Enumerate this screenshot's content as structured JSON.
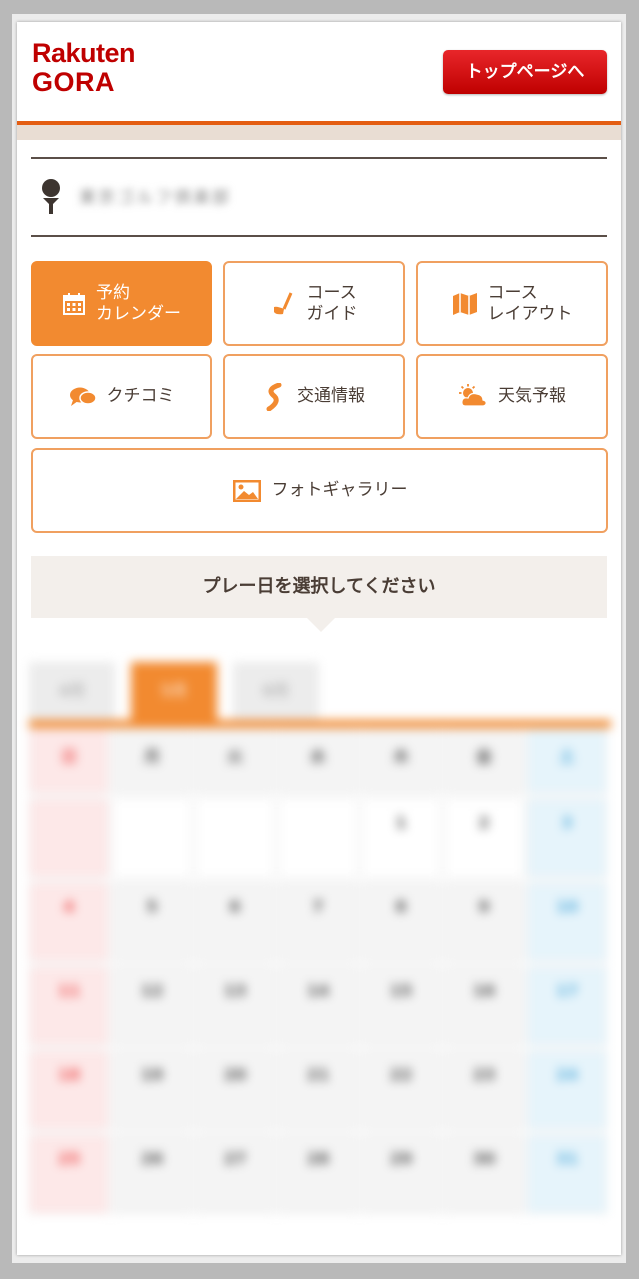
{
  "header": {
    "logo_line1": "Rakuten",
    "logo_line2": "GORA",
    "top_page_button": "トップページへ"
  },
  "course": {
    "name": "東京ゴルフ倶楽部",
    "icon": "golf-tee-icon"
  },
  "nav": [
    {
      "label_line1": "予約",
      "label_line2": "カレンダー",
      "icon": "calendar-icon",
      "active": true
    },
    {
      "label_line1": "コース",
      "label_line2": "ガイド",
      "icon": "golf-club-icon",
      "active": false
    },
    {
      "label_line1": "コース",
      "label_line2": "レイアウト",
      "icon": "map-icon",
      "active": false
    },
    {
      "label_line1": "クチコミ",
      "label_line2": "",
      "icon": "chat-bubbles-icon",
      "active": false
    },
    {
      "label_line1": "交通情報",
      "label_line2": "",
      "icon": "route-icon",
      "active": false
    },
    {
      "label_line1": "天気予報",
      "label_line2": "",
      "icon": "weather-icon",
      "active": false
    },
    {
      "label_line1": "フォトギャラリー",
      "label_line2": "",
      "icon": "image-icon",
      "active": false
    }
  ],
  "prompt": "プレー日を選択してください",
  "calendar": {
    "months": [
      "4月",
      "5月",
      "6月"
    ],
    "active_month_index": 1,
    "weekdays": [
      "日",
      "月",
      "火",
      "水",
      "木",
      "金",
      "土"
    ],
    "rows": [
      [
        "",
        "",
        "",
        "",
        "1",
        "2",
        "3"
      ],
      [
        "4",
        "5",
        "6",
        "7",
        "8",
        "9",
        "10"
      ],
      [
        "11",
        "12",
        "13",
        "14",
        "15",
        "16",
        "17"
      ],
      [
        "18",
        "19",
        "20",
        "21",
        "22",
        "23",
        "24"
      ],
      [
        "25",
        "26",
        "27",
        "28",
        "29",
        "30",
        "31"
      ]
    ]
  },
  "colors": {
    "brand_red": "#bf0000",
    "accent_orange": "#f28a30",
    "text_brown": "#4a3d35"
  }
}
